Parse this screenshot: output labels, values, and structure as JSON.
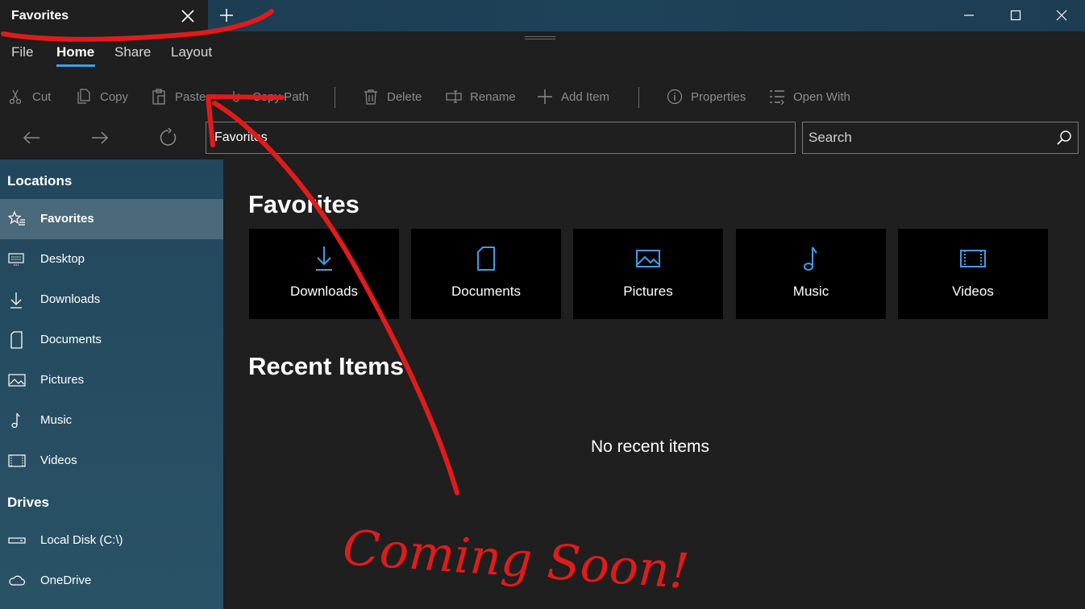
{
  "titlebar": {
    "tab_title": "Favorites",
    "icons": {
      "close_tab": "close-icon",
      "new_tab": "plus-icon",
      "minimize": "minimize-icon",
      "maximize": "maximize-icon",
      "close_window": "close-icon"
    }
  },
  "ribbon": {
    "menu": [
      "File",
      "Home",
      "Share",
      "Layout"
    ],
    "active_menu": "Home",
    "commands": {
      "cut": "Cut",
      "copy": "Copy",
      "paste": "Paste",
      "copy_path": "Copy Path",
      "delete": "Delete",
      "rename": "Rename",
      "add_item": "Add Item",
      "properties": "Properties",
      "open_with": "Open With"
    }
  },
  "navigation": {
    "address": "Favorites",
    "search_placeholder": "Search"
  },
  "sidebar": {
    "locations_header": "Locations",
    "locations": [
      {
        "label": "Favorites",
        "icon": "star-list-icon",
        "selected": true
      },
      {
        "label": "Desktop",
        "icon": "desktop-icon"
      },
      {
        "label": "Downloads",
        "icon": "download-icon"
      },
      {
        "label": "Documents",
        "icon": "document-icon"
      },
      {
        "label": "Pictures",
        "icon": "picture-icon"
      },
      {
        "label": "Music",
        "icon": "music-note-icon"
      },
      {
        "label": "Videos",
        "icon": "film-icon"
      }
    ],
    "drives_header": "Drives",
    "drives": [
      {
        "label": "Local Disk (C:\\)",
        "icon": "drive-icon"
      },
      {
        "label": "OneDrive",
        "icon": "cloud-icon"
      }
    ]
  },
  "main": {
    "favorites_title": "Favorites",
    "favorites": [
      {
        "label": "Downloads",
        "icon": "download-icon"
      },
      {
        "label": "Documents",
        "icon": "document-icon"
      },
      {
        "label": "Pictures",
        "icon": "picture-icon"
      },
      {
        "label": "Music",
        "icon": "music-note-icon"
      },
      {
        "label": "Videos",
        "icon": "film-icon"
      }
    ],
    "recent_title": "Recent Items",
    "no_recent": "No recent items"
  },
  "annotation": {
    "text": "Coming Soon!",
    "color": "#e01b1b"
  },
  "colors": {
    "accent": "#3f9ee8",
    "sidebar": "#22475c",
    "background": "#1f1f1f",
    "tile": "#000000"
  }
}
